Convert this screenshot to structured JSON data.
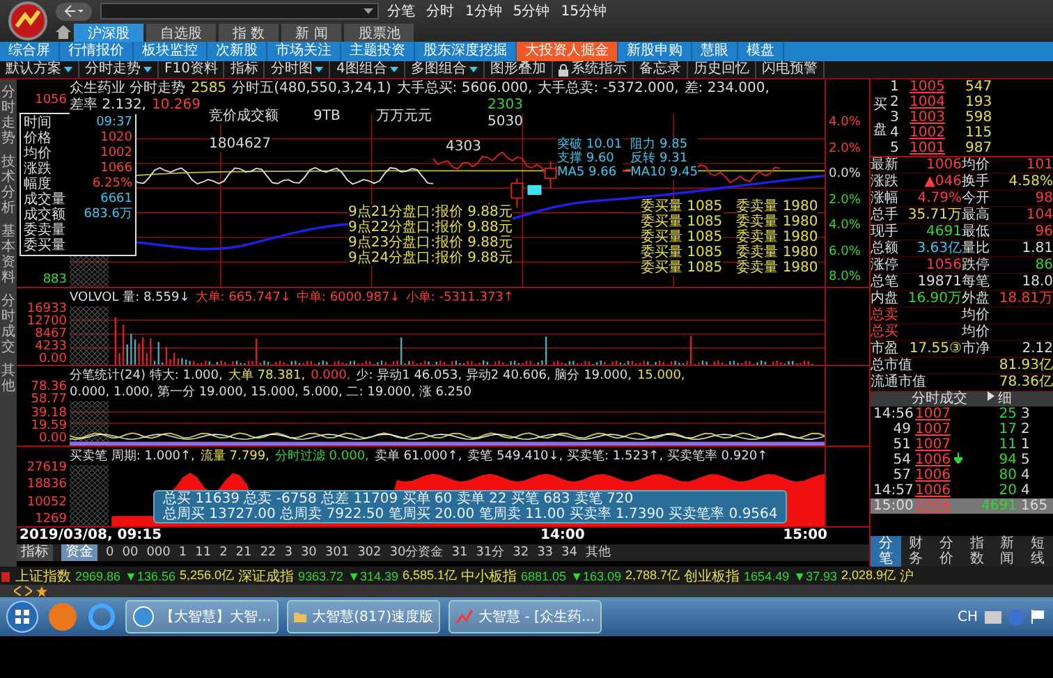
{
  "header": {
    "periods": [
      "分笔",
      "分时",
      "1分钟",
      "5分钟",
      "15分钟"
    ],
    "tabs": [
      {
        "label": "沪深股",
        "selected": true
      },
      {
        "label": "自选股",
        "selected": false
      },
      {
        "label": "指 数",
        "selected": false
      },
      {
        "label": "新 闻",
        "selected": false
      },
      {
        "label": "股票池",
        "selected": false
      }
    ],
    "nav": [
      {
        "label": "综合屏",
        "selected": false
      },
      {
        "label": "行情报价",
        "selected": false
      },
      {
        "label": "板块监控",
        "selected": false
      },
      {
        "label": "次新股",
        "selected": false
      },
      {
        "label": "市场关注",
        "selected": false
      },
      {
        "label": "主题投资",
        "selected": false
      },
      {
        "label": "股东深度挖掘",
        "selected": false
      },
      {
        "label": "大投资人掘金",
        "selected": true
      },
      {
        "label": "新股申购",
        "selected": false
      },
      {
        "label": "慧眼",
        "selected": false
      },
      {
        "label": "模盘",
        "selected": false
      }
    ],
    "toolbar": [
      {
        "label": "默认方案",
        "dropdown": true,
        "locked": false
      },
      {
        "label": "分时走势",
        "dropdown": true,
        "locked": false
      },
      {
        "label": "F10资料",
        "dropdown": false,
        "locked": false
      },
      {
        "label": "指标",
        "dropdown": false,
        "locked": false
      },
      {
        "label": "分时图",
        "dropdown": true,
        "locked": false
      },
      {
        "label": "4图组合",
        "dropdown": true,
        "locked": false
      },
      {
        "label": "多图组合",
        "dropdown": true,
        "locked": false
      },
      {
        "label": "图形叠加",
        "dropdown": false,
        "locked": false
      },
      {
        "label": "系统指示",
        "dropdown": false,
        "locked": true
      },
      {
        "label": "备忘录",
        "dropdown": false,
        "locked": false
      },
      {
        "label": "历史回忆",
        "dropdown": false,
        "locked": false
      },
      {
        "label": "闪电预警",
        "dropdown": false,
        "locked": false
      }
    ]
  },
  "side_tabs": [
    "分时走势",
    "技术分析",
    "基本资料",
    "分时成交",
    "其他"
  ],
  "price_chart": {
    "title_line": [
      {
        "text": "众生药业 分时走势",
        "kind": "label"
      },
      {
        "text": "2585",
        "kind": "code"
      },
      {
        "text": "分时五(480,550,3,24,1)",
        "kind": "label"
      },
      {
        "text": "大手总买: 5606.000,",
        "kind": "label"
      },
      {
        "text": "大手总卖: -5372.000,",
        "kind": "label"
      },
      {
        "text": "差: 234.000,",
        "kind": "label"
      },
      {
        "text": "差率 2.132,",
        "kind": "label"
      },
      {
        "text": "10.269",
        "kind": "up"
      }
    ],
    "axis": [
      {
        "text": "1056",
        "kind": "up"
      },
      {
        "text": "883",
        "kind": "down"
      }
    ],
    "tooltip": [
      {
        "label": "时间",
        "value": "09:37",
        "kind": "volume"
      },
      {
        "label": "价格",
        "value": "1020",
        "kind": "up"
      },
      {
        "label": "均价",
        "value": "1002",
        "kind": "up"
      },
      {
        "label": "涨跌",
        "value": "1066",
        "kind": "up"
      },
      {
        "label": "幅度",
        "value": "6.25%",
        "kind": "up"
      },
      {
        "label": "成交量",
        "value": "6661",
        "kind": "volume"
      },
      {
        "label": "成交额",
        "value": "683.6万",
        "kind": "volume"
      },
      {
        "label": "委卖量",
        "kind": "label"
      },
      {
        "label": "委买量",
        "kind": "label"
      }
    ],
    "annotations": [
      {
        "text": "竞价成交额",
        "kind": "label"
      },
      {
        "text": "9TB",
        "kind": "label"
      },
      {
        "text": "万万元元",
        "kind": "label"
      },
      {
        "text": "2303",
        "kind": "down"
      },
      {
        "text": "5030",
        "kind": "label"
      },
      {
        "text": "4303",
        "kind": "label"
      },
      {
        "text": "1804627",
        "kind": "label"
      }
    ],
    "quotes": [
      "9点21分盘口:报价 9.88元",
      "9点22分盘口:报价 9.88元",
      "9点23分盘口:报价 9.88元",
      "9点24分盘口:报价 9.88元"
    ],
    "orders": [
      {
        "buy": "委买量 1085",
        "sell": "委卖量 1980"
      },
      {
        "buy": "委买量 1085",
        "sell": "委卖量 1980"
      },
      {
        "buy": "委买量 1085",
        "sell": "委卖量 1980"
      },
      {
        "buy": "委买量 1085",
        "sell": "委卖量 1980"
      },
      {
        "buy": "委买量 1085",
        "sell": "委卖量 1980"
      }
    ],
    "levels": [
      "突破 10.01",
      "阻力 9.85",
      "支撑 9.60",
      "反转 9.31",
      "MA5 9.66",
      "MA10 9.45"
    ],
    "pct_axis": [
      {
        "text": "4.0%",
        "kind": "up"
      },
      {
        "text": "2.0%",
        "kind": "up"
      },
      {
        "text": "0.0%",
        "kind": "label"
      },
      {
        "text": "2.0%",
        "kind": "down"
      },
      {
        "text": "4.0%",
        "kind": "down"
      },
      {
        "text": "6.0%",
        "kind": "down"
      },
      {
        "text": "8.0%",
        "kind": "down"
      }
    ]
  },
  "volume_chart": {
    "axis": [
      "16933",
      "12700",
      "8467",
      "4233",
      "0.00"
    ],
    "line": [
      {
        "text": "VOLVOL 量: 8.559↓",
        "kind": "label"
      },
      {
        "text": "大单: 665.747↓",
        "kind": "up"
      },
      {
        "text": "中单: 6000.987↓",
        "kind": "up"
      },
      {
        "text": "小单: -5311.373↑",
        "kind": "up"
      }
    ]
  },
  "indicator_chart": {
    "axis": [
      "78.36",
      "58.77",
      "39.18",
      "19.59",
      "0.00"
    ],
    "line": [
      {
        "text": "分笔统计(24) 特大: 1.000,",
        "kind": "label"
      },
      {
        "text": "大单 78.381,",
        "kind": "code"
      },
      {
        "text": "0.000,",
        "kind": "up"
      },
      {
        "text": "少: 异动1 46.053, 异动2 40.606, 脑分 19.000,",
        "kind": "label"
      },
      {
        "text": "15.000,",
        "kind": "code"
      },
      {
        "text": "0.000, 1.000, 第一分 19.000, 15.000, 5.000, 二: 19.000, 涨 6.250",
        "kind": "label"
      }
    ]
  },
  "flow_chart": {
    "axis": [
      "27619",
      "18836",
      "10052",
      "1269"
    ],
    "line": [
      {
        "text": "买卖笔 周期: 1.000↑,",
        "kind": "label"
      },
      {
        "text": "流量 7.799,",
        "kind": "code"
      },
      {
        "text": "分时过滤 0.000,",
        "kind": "down"
      },
      {
        "text": "卖单 61.000↑,",
        "kind": "label"
      },
      {
        "text": "卖笔 549.410↓, 买卖笔: 1.523↑, 买卖笔率 0.920↑",
        "kind": "label"
      }
    ],
    "summary": [
      "总买 11639  总卖 -6758  总差 11709  买单 60  卖单 22  买笔 683  卖笔 720",
      "总周买 13727.00  总周卖 7922.50  笔周买 20.00  笔周卖 11.00  买卖率 1.7390  买卖笔率 0.9564"
    ]
  },
  "time_axis": {
    "date": "2019/03/08, 09:15",
    "times": [
      "14:00",
      "15:00"
    ],
    "tabs": [
      {
        "label": "指标",
        "selected": false
      },
      {
        "label": "资金",
        "selected": true
      }
    ],
    "ticks": [
      "0",
      "00",
      "000",
      "1",
      "11",
      "2",
      "21",
      "22",
      "3",
      "30",
      "301",
      "302",
      "30分资金",
      "31",
      "31分",
      "32",
      "33",
      "34",
      "其他"
    ]
  },
  "right_panel": {
    "side_label": "买盘",
    "book": [
      {
        "rank": "1",
        "price": "1005",
        "volume": "547"
      },
      {
        "rank": "2",
        "price": "1004",
        "volume": "193"
      },
      {
        "rank": "3",
        "price": "1003",
        "volume": "598"
      },
      {
        "rank": "4",
        "price": "1002",
        "volume": "115"
      },
      {
        "rank": "5",
        "price": "1001",
        "volume": "987"
      }
    ],
    "stats": [
      [
        {
          "label": "最新",
          "value": "1006",
          "kind": "up"
        },
        {
          "label": "均价",
          "value": "101",
          "kind": "up"
        }
      ],
      [
        {
          "label": "涨跌",
          "value": "▲046",
          "kind": "up"
        },
        {
          "label": "换手",
          "value": "4.58%",
          "kind": "code"
        }
      ],
      [
        {
          "label": "涨幅",
          "value": "4.79%",
          "kind": "up"
        },
        {
          "label": "今开",
          "value": "98",
          "kind": "up"
        }
      ],
      [
        {
          "label": "总手",
          "value": "35.71万",
          "kind": "code"
        },
        {
          "label": "最高",
          "value": "104",
          "kind": "up"
        }
      ],
      [
        {
          "label": "现手",
          "value": "4691",
          "kind": "down"
        },
        {
          "label": "最低",
          "value": "96",
          "kind": "up"
        }
      ],
      [
        {
          "label": "总额",
          "value": "3.63亿",
          "kind": "volume"
        },
        {
          "label": "量比",
          "value": "1.81",
          "kind": "label"
        }
      ],
      [
        {
          "label": "涨停",
          "value": "1056",
          "kind": "up"
        },
        {
          "label": "跌停",
          "value": "86",
          "kind": "down"
        }
      ],
      [
        {
          "label": "总笔",
          "value": "19871",
          "kind": "label"
        },
        {
          "label": "每笔",
          "value": "18.0",
          "kind": "label"
        }
      ],
      [
        {
          "label": "内盘",
          "value": "16.90万",
          "kind": "down"
        },
        {
          "label": "外盘",
          "value": "18.81万",
          "kind": "up"
        }
      ],
      [
        {
          "label": "总卖",
          "kind": "up"
        },
        {
          "label": "均价",
          "kind": "label"
        }
      ],
      [
        {
          "label": "总买",
          "kind": "up"
        },
        {
          "label": "均价",
          "kind": "label"
        }
      ],
      [
        {
          "label": "市盈",
          "value": "17.55③",
          "kind": "code"
        },
        {
          "label": "市净",
          "value": "2.12",
          "kind": "label"
        }
      ],
      [
        {
          "label": "总市值",
          "value": "81.93亿",
          "kind": "code"
        }
      ],
      [
        {
          "label": "流通市值",
          "value": "78.36亿",
          "kind": "code"
        }
      ]
    ],
    "trades_title": "分时成交",
    "trades_more": "细",
    "trades": [
      {
        "time": "14:56",
        "price": "1007",
        "volume": "25",
        "count": "3",
        "arrow": false,
        "selected": false
      },
      {
        "time": "49",
        "price": "1007",
        "volume": "17",
        "count": "2",
        "arrow": false,
        "selected": false
      },
      {
        "time": "51",
        "price": "1007",
        "volume": "11",
        "count": "1",
        "arrow": false,
        "selected": false
      },
      {
        "time": "54",
        "price": "1006",
        "volume": "94",
        "count": "5",
        "arrow": true,
        "selected": false
      },
      {
        "time": "57",
        "price": "1006",
        "volume": "80",
        "count": "4",
        "arrow": false,
        "selected": false
      },
      {
        "time": "14:57",
        "price": "1006",
        "volume": "20",
        "count": "4",
        "arrow": false,
        "selected": false
      },
      {
        "time": "15:00",
        "price": "1006",
        "volume": "4691",
        "count": "165",
        "arrow": false,
        "selected": true
      }
    ],
    "tabs": [
      {
        "label": "分笔",
        "selected": true
      },
      {
        "label": "财务",
        "selected": false
      },
      {
        "label": "分价",
        "selected": false
      },
      {
        "label": "指数",
        "selected": false
      },
      {
        "label": "新闻",
        "selected": false
      },
      {
        "label": "短线",
        "selected": false
      }
    ]
  },
  "ticker": {
    "items": [
      {
        "name": "上证指数",
        "price": "2969.86",
        "change": "▼136.56",
        "amount": "5,256.0亿"
      },
      {
        "name": "深证成指",
        "price": "9363.72",
        "change": "▼314.39",
        "amount": "6,585.1亿"
      },
      {
        "name": "中小板指",
        "price": "6881.05",
        "change": "▼163.09",
        "amount": "2,788.7亿"
      },
      {
        "name": "创业板指",
        "price": "1654.49",
        "change": "▼37.93",
        "amount": "2,028.9亿"
      }
    ],
    "tail": "沪"
  },
  "taskbar": {
    "tasks": [
      {
        "label": "【大智慧】大智...",
        "kind": "browser"
      },
      {
        "label": "大智慧(817)速度版",
        "kind": "folder"
      },
      {
        "label": "大智慧 - [众生药...",
        "kind": "app"
      }
    ],
    "language": "CH"
  }
}
